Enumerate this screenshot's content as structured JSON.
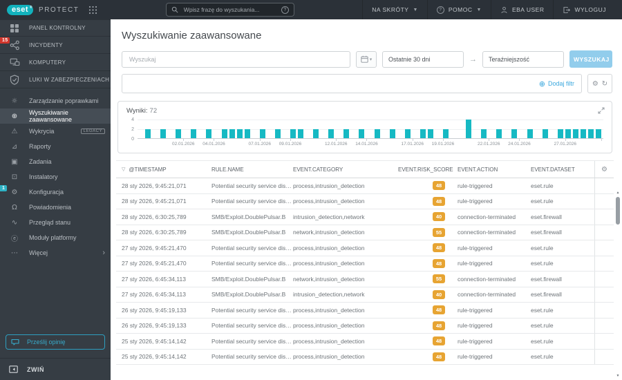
{
  "colors": {
    "topbar_bg": "#2b3138",
    "sidebar_bg": "#363d44",
    "sidebar_selected_bg": "#454d55",
    "brand_teal": "#12b2bd",
    "badge_red": "#d1362c",
    "badge_teal": "#2fb3c6",
    "link_blue": "#3aa7dd",
    "search_button_blue": "#92cdec",
    "chart_bar_teal": "#16b9c3",
    "risk_badge_amber": "#e7a432"
  },
  "topbar": {
    "brand": "eset",
    "product": "PROTECT",
    "search_placeholder": "Wpisz frazę do wyszukania...",
    "shortcuts_label": "NA SKRÓTY",
    "help_label": "POMOC",
    "user_label": "EBA USER",
    "logout_label": "WYLOGUJ"
  },
  "sidebar": {
    "primary": [
      {
        "label": "PANEL KONTROLNY",
        "icon": "dashboard-icon"
      },
      {
        "label": "INCYDENTY",
        "icon": "incidents-icon",
        "badge": "15"
      },
      {
        "label": "KOMPUTERY",
        "icon": "computers-icon"
      },
      {
        "label": "LUKI W ZABEZPIECZENIACH",
        "icon": "vulnerabilities-shield-icon"
      }
    ],
    "secondary": [
      {
        "label": "Zarządzanie poprawkami",
        "icon": "patch-management-icon"
      },
      {
        "label": "Wyszukiwanie zaawansowane",
        "icon": "advanced-search-icon",
        "selected": true
      },
      {
        "label": "Wykrycia",
        "icon": "detections-warning-icon",
        "tag": "LEGACY"
      },
      {
        "label": "Raporty",
        "icon": "reports-chart-icon"
      },
      {
        "label": "Zadania",
        "icon": "tasks-icon"
      },
      {
        "label": "Instalatory",
        "icon": "installers-icon"
      },
      {
        "label": "Konfiguracja",
        "icon": "configuration-gear-icon",
        "badge": "1"
      },
      {
        "label": "Powiadomienia",
        "icon": "notifications-bell-icon"
      },
      {
        "label": "Przegląd stanu",
        "icon": "status-overview-icon"
      },
      {
        "label": "Moduły platformy",
        "icon": "platform-modules-icon"
      },
      {
        "label": "Więcej",
        "icon": "more-ellipsis-icon",
        "chevron": "›"
      }
    ],
    "feedback_label": "Prześlij opinię",
    "collapse_label": "ZWIŃ"
  },
  "main": {
    "title": "Wyszukiwanie zaawansowane",
    "search_placeholder": "Wyszukaj",
    "date_from": "Ostatnie 30 dni",
    "date_to": "Teraźniejszość",
    "search_button": "WYSZUKAJ",
    "add_filter": "Dodaj filtr"
  },
  "results": {
    "label": "Wyniki:",
    "count": "72"
  },
  "chart_data": {
    "type": "bar",
    "title": "Wyniki: 72",
    "xlabel": "",
    "ylabel": "",
    "ylim": [
      0,
      4
    ],
    "yticks": [
      0,
      2,
      4
    ],
    "grid": true,
    "legend": "none",
    "x_tick_labels": [
      "02.01.2026",
      "04.01.2026",
      "07.01.2026",
      "09.01.2026",
      "12.01.2026",
      "14.01.2026",
      "17.01.2026",
      "19.01.2026",
      "22.01.2026",
      "24.01.2026",
      "27.01.2026"
    ],
    "tick_slots": [
      6,
      10,
      16,
      20,
      26,
      30,
      36,
      40,
      46,
      50,
      56
    ],
    "total_slots": 61,
    "bars": [
      {
        "slot": 1,
        "count": 2
      },
      {
        "slot": 3,
        "count": 2
      },
      {
        "slot": 5,
        "count": 2
      },
      {
        "slot": 7,
        "count": 2
      },
      {
        "slot": 9,
        "count": 2
      },
      {
        "slot": 11,
        "count": 2
      },
      {
        "slot": 12,
        "count": 2
      },
      {
        "slot": 13,
        "count": 2
      },
      {
        "slot": 14,
        "count": 2
      },
      {
        "slot": 16,
        "count": 2
      },
      {
        "slot": 18,
        "count": 2
      },
      {
        "slot": 20,
        "count": 2
      },
      {
        "slot": 21,
        "count": 2
      },
      {
        "slot": 23,
        "count": 2
      },
      {
        "slot": 25,
        "count": 2
      },
      {
        "slot": 27,
        "count": 2
      },
      {
        "slot": 29,
        "count": 2
      },
      {
        "slot": 31,
        "count": 2
      },
      {
        "slot": 33,
        "count": 2
      },
      {
        "slot": 35,
        "count": 2
      },
      {
        "slot": 37,
        "count": 2
      },
      {
        "slot": 38,
        "count": 2
      },
      {
        "slot": 40,
        "count": 2
      },
      {
        "slot": 43,
        "count": 4
      },
      {
        "slot": 45,
        "count": 2
      },
      {
        "slot": 47,
        "count": 2
      },
      {
        "slot": 49,
        "count": 2
      },
      {
        "slot": 51,
        "count": 2
      },
      {
        "slot": 53,
        "count": 2
      },
      {
        "slot": 55,
        "count": 2
      },
      {
        "slot": 56,
        "count": 2
      },
      {
        "slot": 57,
        "count": 2
      },
      {
        "slot": 58,
        "count": 2
      },
      {
        "slot": 59,
        "count": 2
      },
      {
        "slot": 60,
        "count": 2
      }
    ]
  },
  "table": {
    "columns": [
      "@TIMESTAMP",
      "RULE.NAME",
      "EVENT.CATEGORY",
      "EVENT.RISK_SCORE",
      "EVENT.ACTION",
      "EVENT.DATASET"
    ],
    "rows": [
      {
        "timestamp": "28 sty 2026, 9:45:21,071",
        "rule_name": "Potential security service disco...",
        "category": "process,intrusion_detection",
        "risk_score": "48",
        "action": "rule-triggered",
        "dataset": "eset.rule"
      },
      {
        "timestamp": "28 sty 2026, 9:45:21,071",
        "rule_name": "Potential security service disco...",
        "category": "process,intrusion_detection",
        "risk_score": "48",
        "action": "rule-triggered",
        "dataset": "eset.rule"
      },
      {
        "timestamp": "28 sty 2026, 6:30:25,789",
        "rule_name": "SMB/Exploit.DoublePulsar.B",
        "category": "intrusion_detection,network",
        "risk_score": "40",
        "action": "connection-terminated",
        "dataset": "eset.firewall"
      },
      {
        "timestamp": "28 sty 2026, 6:30:25,789",
        "rule_name": "SMB/Exploit.DoublePulsar.B",
        "category": "network,intrusion_detection",
        "risk_score": "55",
        "action": "connection-terminated",
        "dataset": "eset.firewall"
      },
      {
        "timestamp": "27 sty 2026, 9:45:21,470",
        "rule_name": "Potential security service disco...",
        "category": "process,intrusion_detection",
        "risk_score": "48",
        "action": "rule-triggered",
        "dataset": "eset.rule"
      },
      {
        "timestamp": "27 sty 2026, 9:45:21,470",
        "rule_name": "Potential security service disco...",
        "category": "process,intrusion_detection",
        "risk_score": "48",
        "action": "rule-triggered",
        "dataset": "eset.rule"
      },
      {
        "timestamp": "27 sty 2026, 6:45:34,113",
        "rule_name": "SMB/Exploit.DoublePulsar.B",
        "category": "network,intrusion_detection",
        "risk_score": "55",
        "action": "connection-terminated",
        "dataset": "eset.firewall"
      },
      {
        "timestamp": "27 sty 2026, 6:45:34,113",
        "rule_name": "SMB/Exploit.DoublePulsar.B",
        "category": "intrusion_detection,network",
        "risk_score": "40",
        "action": "connection-terminated",
        "dataset": "eset.firewall"
      },
      {
        "timestamp": "26 sty 2026, 9:45:19,133",
        "rule_name": "Potential security service disco...",
        "category": "process,intrusion_detection",
        "risk_score": "48",
        "action": "rule-triggered",
        "dataset": "eset.rule"
      },
      {
        "timestamp": "26 sty 2026, 9:45:19,133",
        "rule_name": "Potential security service disco...",
        "category": "process,intrusion_detection",
        "risk_score": "48",
        "action": "rule-triggered",
        "dataset": "eset.rule"
      },
      {
        "timestamp": "25 sty 2026, 9:45:14,142",
        "rule_name": "Potential security service disco...",
        "category": "process,intrusion_detection",
        "risk_score": "48",
        "action": "rule-triggered",
        "dataset": "eset.rule"
      },
      {
        "timestamp": "25 sty 2026, 9:45:14,142",
        "rule_name": "Potential security service disco...",
        "category": "process,intrusion_detection",
        "risk_score": "48",
        "action": "rule-triggered",
        "dataset": "eset.rule"
      }
    ]
  }
}
